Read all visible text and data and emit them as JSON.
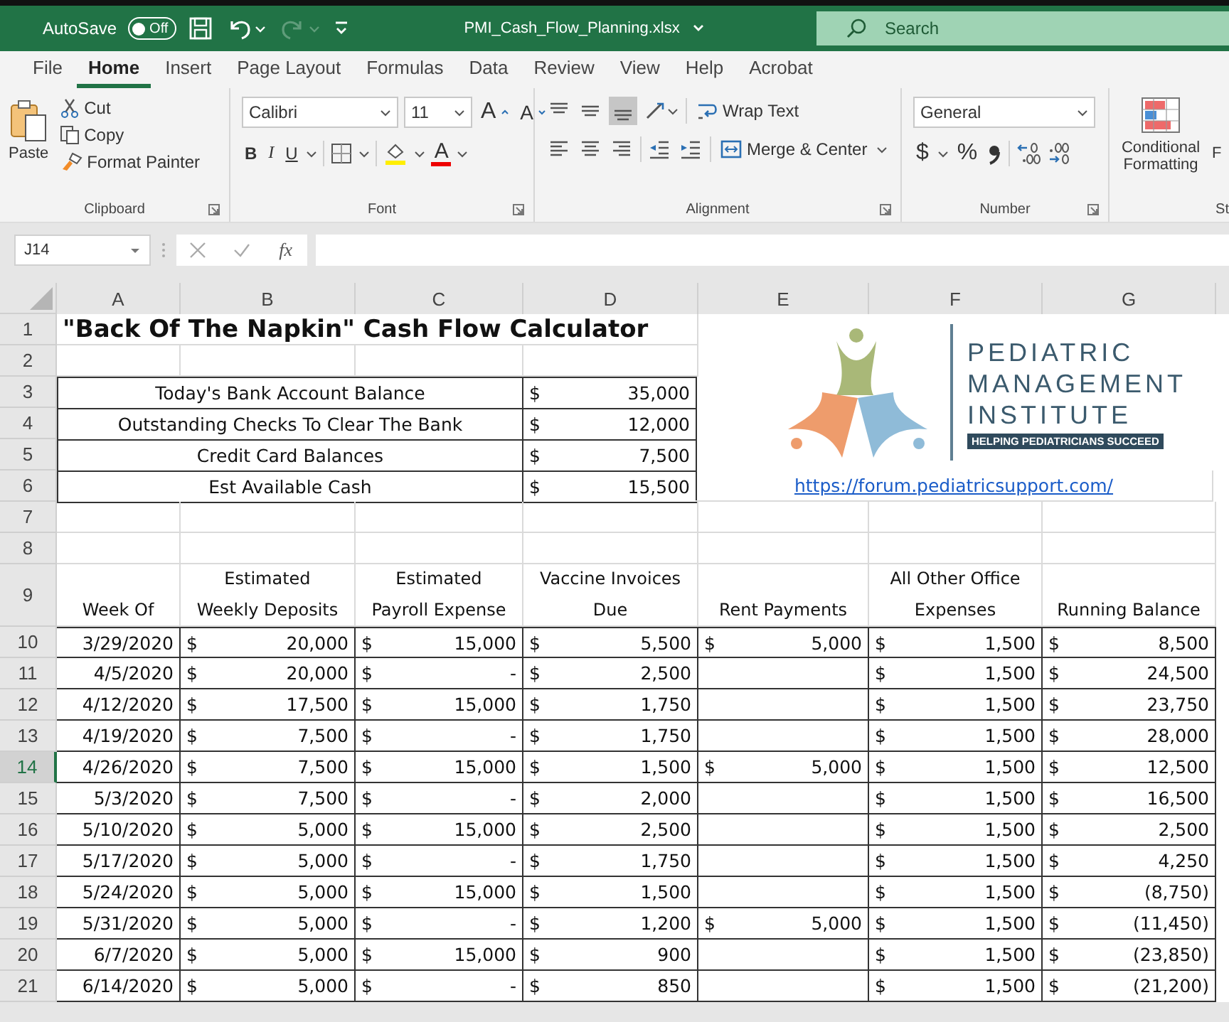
{
  "title_bar": {
    "autosave_label": "AutoSave",
    "autosave_state": "Off",
    "autosave_on": false,
    "filename": "PMI_Cash_Flow_Planning.xlsx",
    "search_placeholder": "Search"
  },
  "menu_tabs": [
    {
      "label": "File",
      "selected": false
    },
    {
      "label": "Home",
      "selected": true
    },
    {
      "label": "Insert",
      "selected": false
    },
    {
      "label": "Page Layout",
      "selected": false
    },
    {
      "label": "Formulas",
      "selected": false
    },
    {
      "label": "Data",
      "selected": false
    },
    {
      "label": "Review",
      "selected": false
    },
    {
      "label": "View",
      "selected": false
    },
    {
      "label": "Help",
      "selected": false
    },
    {
      "label": "Acrobat",
      "selected": false
    }
  ],
  "ribbon": {
    "clipboard": {
      "label": "Clipboard",
      "paste": "Paste",
      "cut": "Cut",
      "copy": "Copy",
      "format_painter": "Format Painter"
    },
    "font": {
      "label": "Font",
      "family": "Calibri",
      "size": "11",
      "grow": "A",
      "shrink": "A",
      "bold": "B",
      "italic": "I",
      "underline": "U",
      "font_color": "A"
    },
    "alignment": {
      "label": "Alignment",
      "wrap_text": "Wrap Text",
      "merge_center": "Merge & Center"
    },
    "number": {
      "label": "Number",
      "format": "General",
      "currency": "$",
      "percent": "%"
    },
    "styles": {
      "label": "St",
      "conditional_formatting": "Conditional Formatting",
      "next_button": "F"
    }
  },
  "formula_bar": {
    "name_box": "J14",
    "fx": "fx"
  },
  "sheet": {
    "columns": [
      "A",
      "B",
      "C",
      "D",
      "E",
      "F",
      "G"
    ],
    "row_headers": [
      {
        "label": "1",
        "selected": false
      },
      {
        "label": "2",
        "selected": false
      },
      {
        "label": "3",
        "selected": false
      },
      {
        "label": "4",
        "selected": false
      },
      {
        "label": "5",
        "selected": false
      },
      {
        "label": "6",
        "selected": false
      },
      {
        "label": "7",
        "selected": false
      },
      {
        "label": "8",
        "selected": false
      },
      {
        "label": "9",
        "selected": false
      },
      {
        "label": "10",
        "selected": false
      },
      {
        "label": "11",
        "selected": false
      },
      {
        "label": "12",
        "selected": false
      },
      {
        "label": "13",
        "selected": false
      },
      {
        "label": "14",
        "selected": true
      },
      {
        "label": "15",
        "selected": false
      },
      {
        "label": "16",
        "selected": false
      },
      {
        "label": "17",
        "selected": false
      },
      {
        "label": "18",
        "selected": false
      },
      {
        "label": "19",
        "selected": false
      },
      {
        "label": "20",
        "selected": false
      },
      {
        "label": "21",
        "selected": false
      }
    ],
    "title": "\"Back Of The Napkin\" Cash Flow Calculator",
    "summary": [
      {
        "label": "Today's Bank Account Balance",
        "sign": "$",
        "amount": "35,000"
      },
      {
        "label": "Outstanding Checks To Clear The Bank",
        "sign": "$",
        "amount": "12,000"
      },
      {
        "label": "Credit Card Balances",
        "sign": "$",
        "amount": "7,500"
      },
      {
        "label": "Est Available Cash",
        "sign": "$",
        "amount": "15,500"
      }
    ],
    "logo": {
      "lines": [
        "PEDIATRIC",
        "MANAGEMENT",
        "INSTITUTE"
      ],
      "tagline": "HELPING PEDIATRICIANS SUCCEED"
    },
    "link": "https://forum.pediatricsupport.com/",
    "headers": [
      [
        "Week Of"
      ],
      [
        "Estimated",
        "Weekly Deposits"
      ],
      [
        "Estimated",
        "Payroll Expense"
      ],
      [
        "Vaccine Invoices",
        "Due"
      ],
      [
        "Rent Payments"
      ],
      [
        "All Other Office",
        "Expenses"
      ],
      [
        "Running Balance"
      ]
    ],
    "rows": [
      {
        "week": "3/29/2020",
        "deposits": "20,000",
        "payroll": "15,000",
        "vaccine": "5,500",
        "rent": "5,000",
        "other": "1,500",
        "balance": "8,500"
      },
      {
        "week": "4/5/2020",
        "deposits": "20,000",
        "payroll": "-",
        "vaccine": "2,500",
        "other": "1,500",
        "balance": "24,500"
      },
      {
        "week": "4/12/2020",
        "deposits": "17,500",
        "payroll": "15,000",
        "vaccine": "1,750",
        "other": "1,500",
        "balance": "23,750"
      },
      {
        "week": "4/19/2020",
        "deposits": "7,500",
        "payroll": "-",
        "vaccine": "1,750",
        "other": "1,500",
        "balance": "28,000"
      },
      {
        "week": "4/26/2020",
        "deposits": "7,500",
        "payroll": "15,000",
        "vaccine": "1,500",
        "rent": "5,000",
        "other": "1,500",
        "balance": "12,500"
      },
      {
        "week": "5/3/2020",
        "deposits": "7,500",
        "payroll": "-",
        "vaccine": "2,000",
        "other": "1,500",
        "balance": "16,500"
      },
      {
        "week": "5/10/2020",
        "deposits": "5,000",
        "payroll": "15,000",
        "vaccine": "2,500",
        "other": "1,500",
        "balance": "2,500"
      },
      {
        "week": "5/17/2020",
        "deposits": "5,000",
        "payroll": "-",
        "vaccine": "1,750",
        "other": "1,500",
        "balance": "4,250"
      },
      {
        "week": "5/24/2020",
        "deposits": "5,000",
        "payroll": "15,000",
        "vaccine": "1,500",
        "other": "1,500",
        "balance": "(8,750)"
      },
      {
        "week": "5/31/2020",
        "deposits": "5,000",
        "payroll": "-",
        "vaccine": "1,200",
        "rent": "5,000",
        "other": "1,500",
        "balance": "(11,450)"
      },
      {
        "week": "6/7/2020",
        "deposits": "5,000",
        "payroll": "15,000",
        "vaccine": "900",
        "other": "1,500",
        "balance": "(23,850)"
      },
      {
        "week": "6/14/2020",
        "deposits": "5,000",
        "payroll": "-",
        "vaccine": "850",
        "other": "1,500",
        "balance": "(21,200)"
      }
    ],
    "currency_sign": "$"
  }
}
